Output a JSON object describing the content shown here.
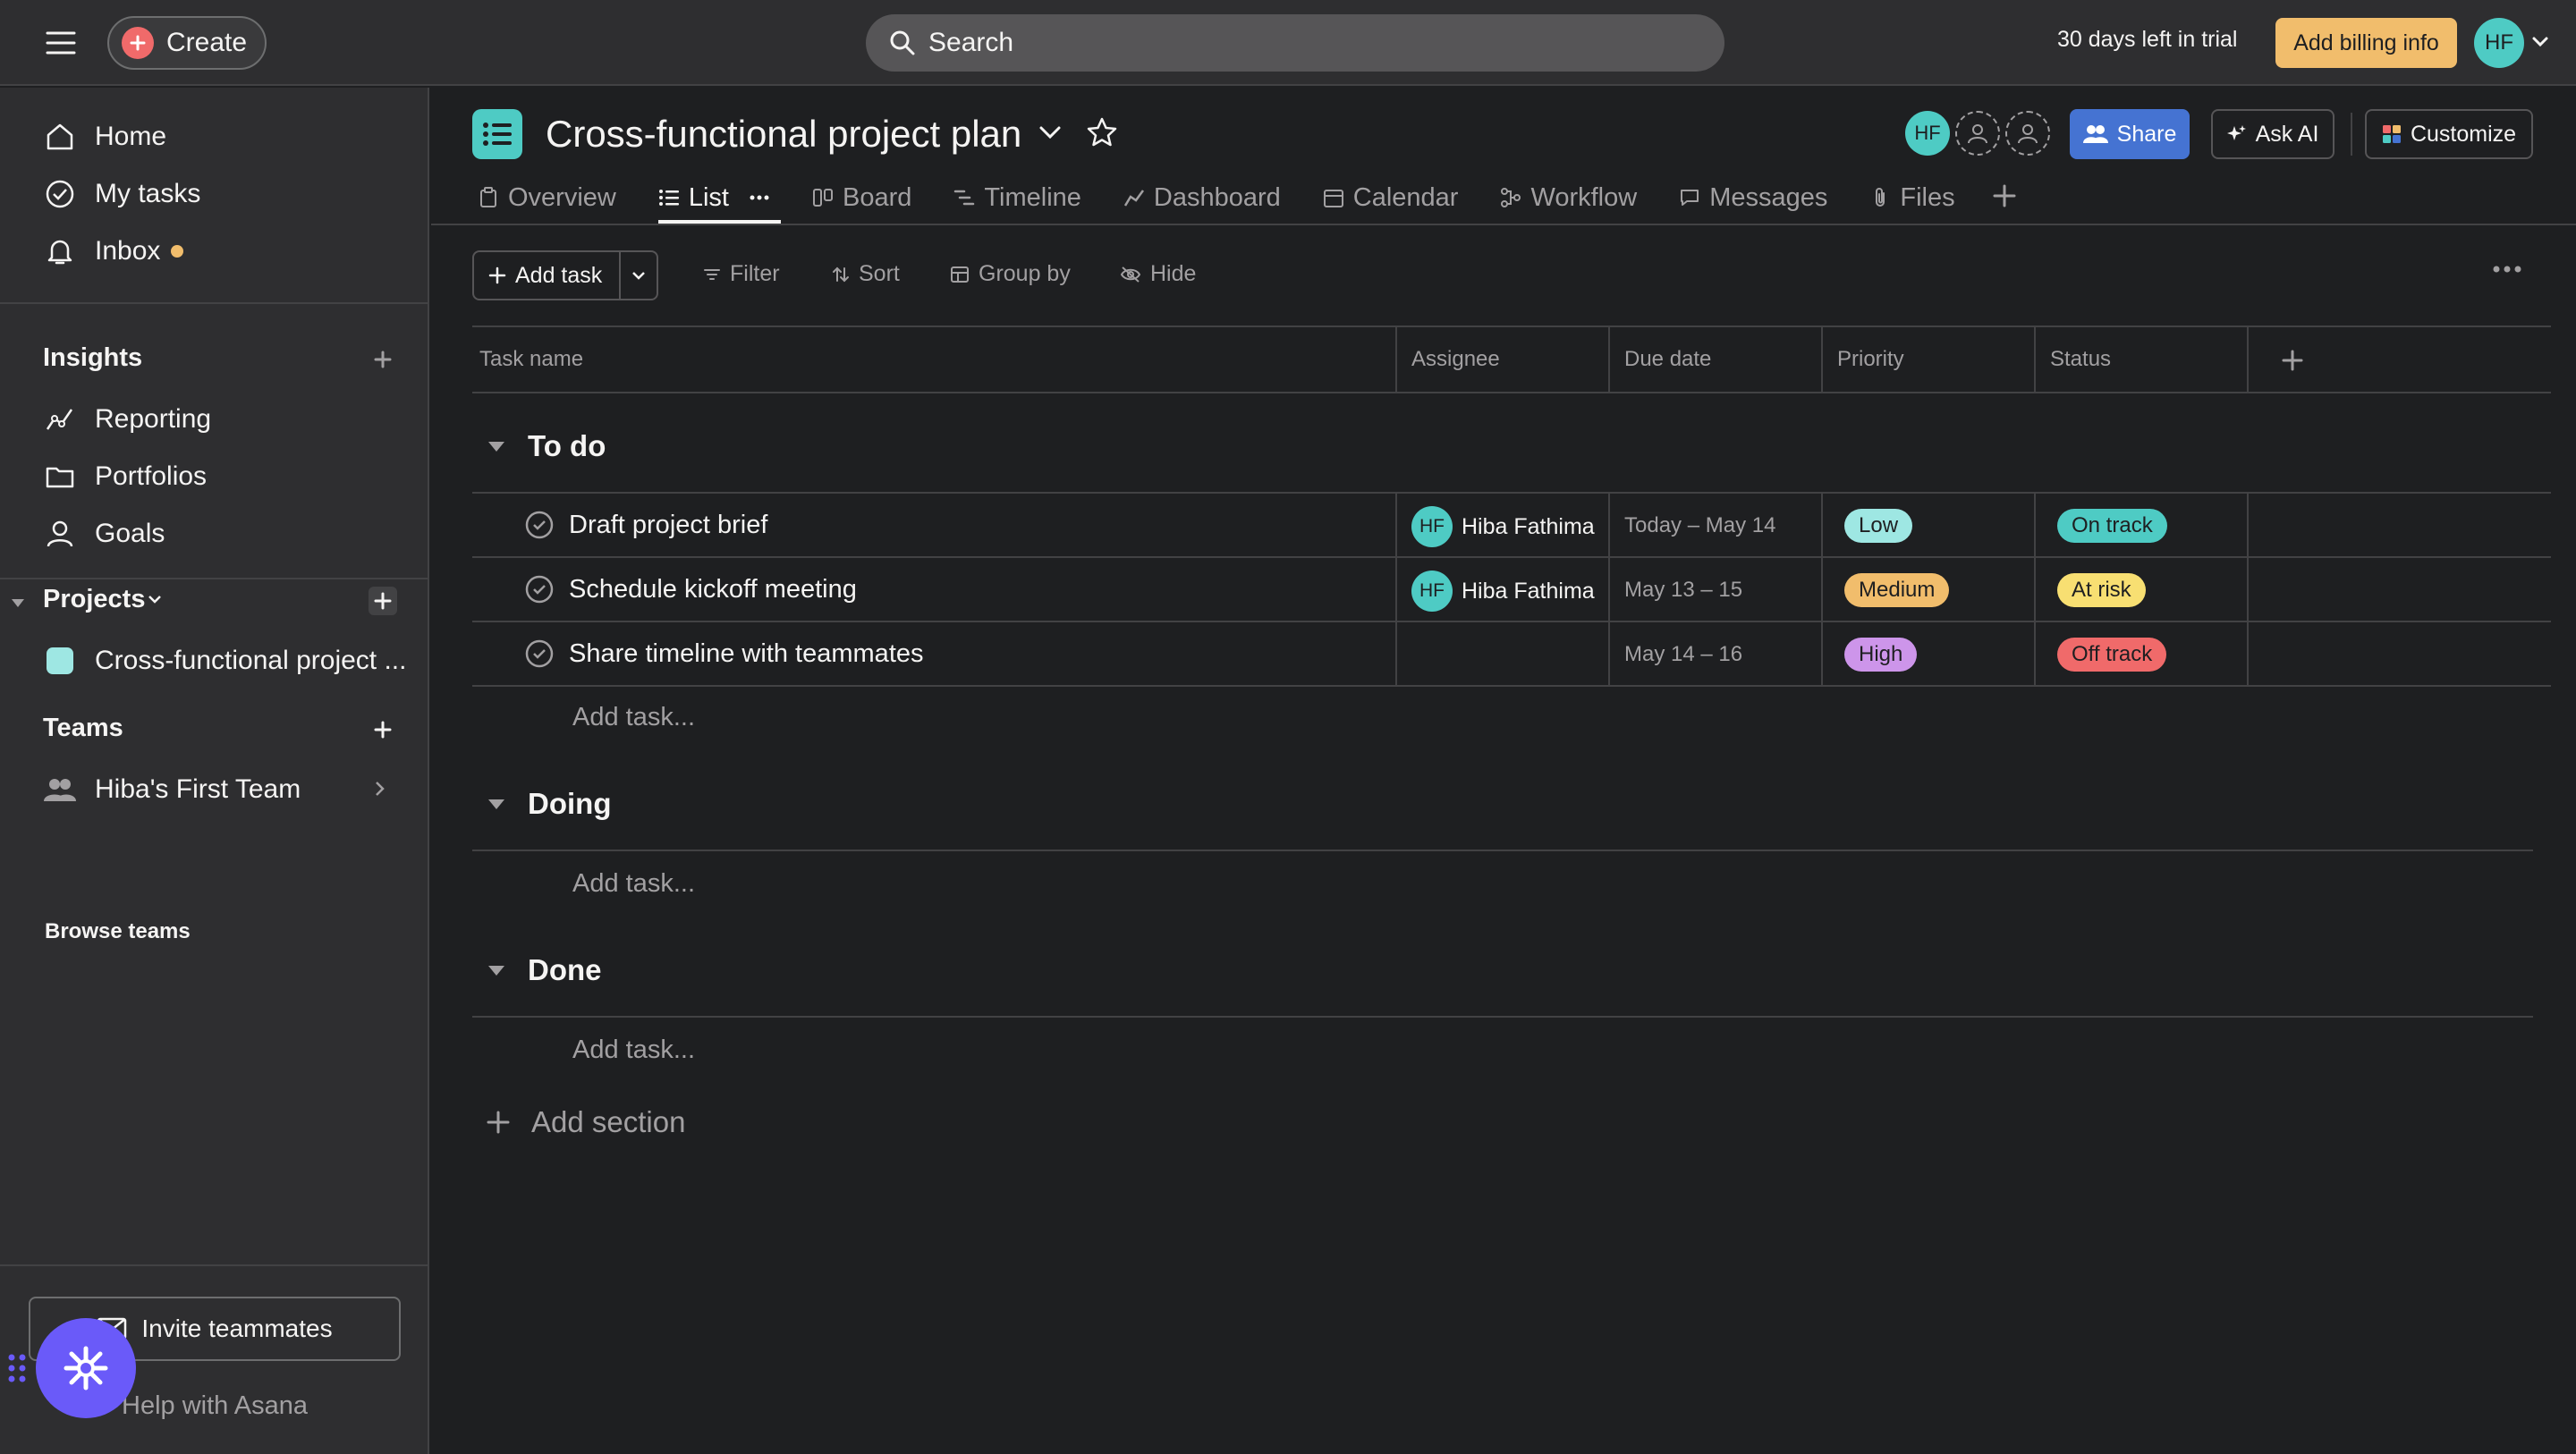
{
  "topbar": {
    "create_label": "Create",
    "search_placeholder": "Search",
    "trial_text": "30 days left in trial",
    "billing_label": "Add billing info",
    "user_initials": "HF"
  },
  "sidebar": {
    "nav": [
      {
        "label": "Home",
        "icon": "home-icon"
      },
      {
        "label": "My tasks",
        "icon": "check-circle-icon"
      },
      {
        "label": "Inbox",
        "icon": "bell-icon"
      }
    ],
    "insights_heading": "Insights",
    "insights": [
      {
        "label": "Reporting",
        "icon": "chart-line-icon"
      },
      {
        "label": "Portfolios",
        "icon": "folder-icon"
      },
      {
        "label": "Goals",
        "icon": "person-icon"
      }
    ],
    "projects_heading": "Projects",
    "projects": [
      {
        "label": "Cross-functional project ...",
        "color": "#9ee7e3"
      }
    ],
    "teams_heading": "Teams",
    "teams": [
      {
        "label": "Hiba's First Team"
      }
    ],
    "browse_teams": "Browse teams",
    "invite_label": "Invite teammates",
    "help_label": "Help with Asana"
  },
  "project": {
    "title": "Cross-functional project plan",
    "member_initials": "HF",
    "share_label": "Share",
    "ask_ai_label": "Ask AI",
    "customize_label": "Customize",
    "tabs": [
      {
        "label": "Overview",
        "icon": "clipboard-icon"
      },
      {
        "label": "List",
        "icon": "list-icon"
      },
      {
        "label": "Board",
        "icon": "board-icon"
      },
      {
        "label": "Timeline",
        "icon": "timeline-icon"
      },
      {
        "label": "Dashboard",
        "icon": "dashboard-icon"
      },
      {
        "label": "Calendar",
        "icon": "calendar-icon"
      },
      {
        "label": "Workflow",
        "icon": "workflow-icon"
      },
      {
        "label": "Messages",
        "icon": "message-icon"
      },
      {
        "label": "Files",
        "icon": "paperclip-icon"
      }
    ],
    "active_tab": "List"
  },
  "toolbar": {
    "add_task_label": "Add task",
    "filter_label": "Filter",
    "sort_label": "Sort",
    "group_by_label": "Group by",
    "hide_label": "Hide"
  },
  "table": {
    "columns": [
      "Task name",
      "Assignee",
      "Due date",
      "Priority",
      "Status"
    ],
    "sections": [
      {
        "title": "To do",
        "tasks": [
          {
            "name": "Draft project brief",
            "assignee_initials": "HF",
            "assignee": "Hiba Fathima",
            "due": "Today – May 14",
            "priority": "Low",
            "priority_color": "#9ee7e3",
            "status": "On track",
            "status_color": "#4ecbc4"
          },
          {
            "name": "Schedule kickoff meeting",
            "assignee_initials": "HF",
            "assignee": "Hiba Fathima",
            "due": "May 13 – 15",
            "priority": "Medium",
            "priority_color": "#f1bd6c",
            "status": "At risk",
            "status_color": "#f8df72"
          },
          {
            "name": "Share timeline with teammates",
            "assignee_initials": "",
            "assignee": "",
            "due": "May 14 – 16",
            "priority": "High",
            "priority_color": "#cd95ea",
            "status": "Off track",
            "status_color": "#f06a6a"
          }
        ]
      },
      {
        "title": "Doing",
        "tasks": []
      },
      {
        "title": "Done",
        "tasks": []
      }
    ],
    "add_task_placeholder": "Add task...",
    "add_section_label": "Add section"
  }
}
